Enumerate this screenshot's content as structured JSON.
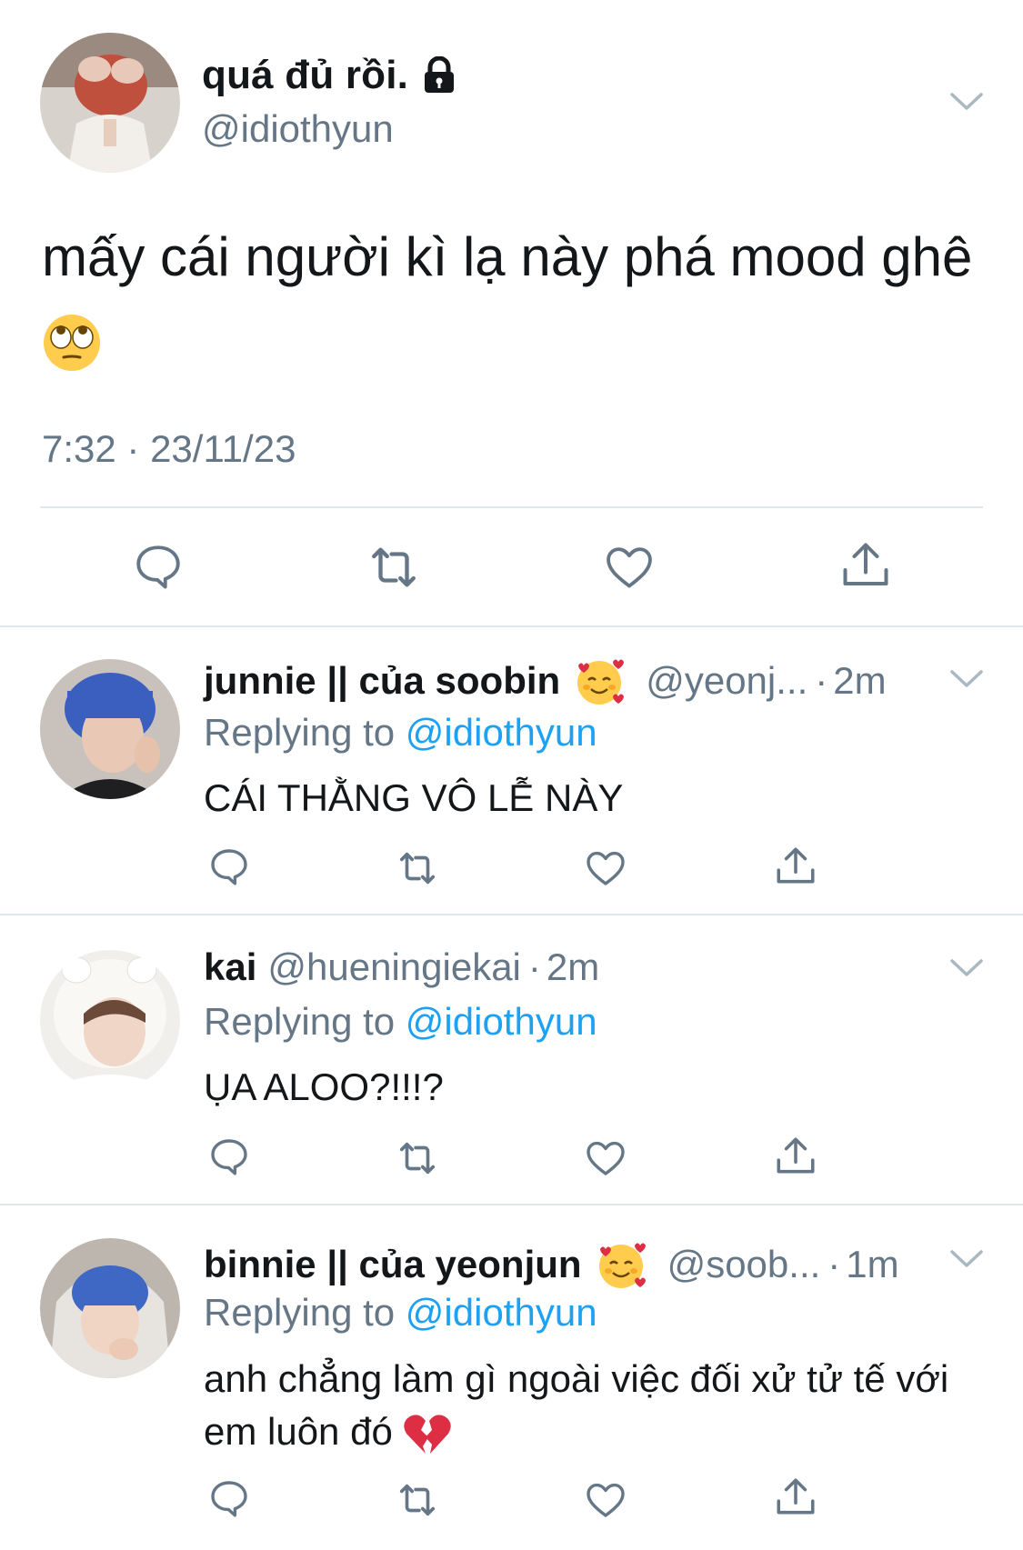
{
  "main_tweet": {
    "display_name": "quá đủ rồi.",
    "handle": "@idiothyun",
    "text": "mấy cái người kì lạ này phá mood ghê",
    "timestamp": "7:32 · 23/11/23",
    "emoji": "face-with-rolling-eyes",
    "locked": true
  },
  "actions": [
    "reply-icon",
    "retweet-icon",
    "like-icon",
    "share-icon"
  ],
  "replies": [
    {
      "display_name": "junnie || của soobin",
      "handle": "@yeonj...",
      "time": "2m",
      "replying_prefix": "Replying to ",
      "replying_to": "@idiothyun",
      "text": "CÁI THẰNG VÔ LỄ NÀY"
    },
    {
      "display_name": "kai",
      "handle": "@hueningiekai",
      "time": "2m",
      "replying_prefix": "Replying to ",
      "replying_to": "@idiothyun",
      "text": "ỤA ALOO?!!!?"
    },
    {
      "display_name": "binnie || của yeonjun",
      "handle": "@soob...",
      "time": "1m",
      "replying_prefix": "Replying to ",
      "replying_to": "@idiothyun",
      "text": "anh chẳng làm gì ngoài việc đối xử tử tế với em luôn đó"
    }
  ],
  "colors": {
    "text": "#14171a",
    "secondary": "#657786",
    "link": "#1da1f2",
    "icon": "#657786",
    "divider": "#e1e8ed"
  }
}
